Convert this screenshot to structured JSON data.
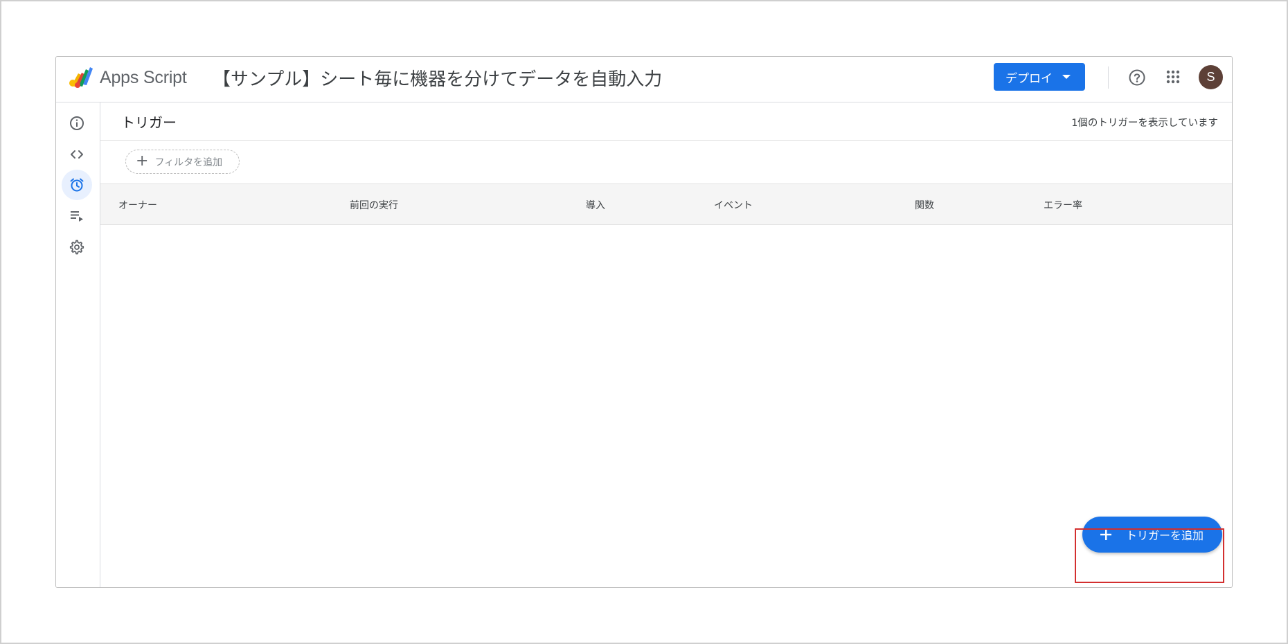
{
  "header": {
    "app_name": "Apps Script",
    "project_title": "【サンプル】シート毎に機器を分けてデータを自動入力",
    "deploy_label": "デプロイ",
    "avatar_initial": "S"
  },
  "sidebar": {
    "items": [
      {
        "icon": "info-icon",
        "label": "Overview",
        "active": false
      },
      {
        "icon": "code-icon",
        "label": "Editor",
        "active": false
      },
      {
        "icon": "alarm-clock-icon",
        "label": "Triggers",
        "active": true
      },
      {
        "icon": "executions-icon",
        "label": "Executions",
        "active": false
      },
      {
        "icon": "gear-icon",
        "label": "Project Settings",
        "active": false
      }
    ]
  },
  "page": {
    "title": "トリガー",
    "count_text": "1個のトリガーを表示しています",
    "filter_label": "フィルタを追加"
  },
  "table": {
    "columns": [
      "オーナー",
      "前回の実行",
      "導入",
      "イベント",
      "関数",
      "エラー率"
    ],
    "rows": []
  },
  "fab": {
    "label": "トリガーを追加"
  },
  "colors": {
    "accent": "#1a73e8",
    "highlight": "#d32f2f",
    "avatar": "#5d4037"
  }
}
